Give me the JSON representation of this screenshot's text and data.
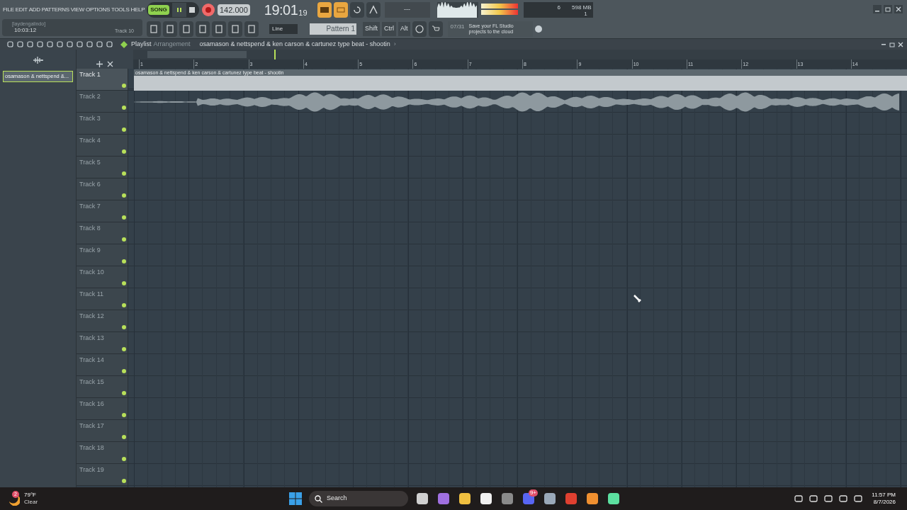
{
  "menu": [
    "FILE",
    "EDIT",
    "ADD",
    "PATTERNS",
    "VIEW",
    "OPTIONS",
    "TOOLS",
    "HELP"
  ],
  "transport": {
    "mode_label": "SONG",
    "song_mode": true,
    "playing": true,
    "tempo": "142.000",
    "time": "19:01",
    "time_seconds": "19",
    "monitor": "---"
  },
  "info": {
    "user": "[laydengalindo]",
    "time": "10:03:12",
    "track": "Track 10"
  },
  "resources": {
    "cpu": "6",
    "memory": "598 MB",
    "polyphony": "1"
  },
  "snap": "Line",
  "pattern": "Pattern 1",
  "mod_keys": [
    "Shift",
    "Ctrl",
    "Alt"
  ],
  "hint": {
    "date": "07/31",
    "text": "Save your FL Studio projects to the cloud"
  },
  "playlist": {
    "title": "Playlist",
    "subtitle": "Arrangement",
    "project": "osamason & nettspend & ken carson & cartunez type beat - shootin",
    "chevron": "›"
  },
  "picker_clip": "osamason & nettspend &...",
  "ruler": [
    "1",
    "2",
    "3",
    "4",
    "5",
    "6",
    "7",
    "8",
    "9",
    "10",
    "11",
    "12",
    "13",
    "14"
  ],
  "tracks": [
    {
      "name": "Track 1",
      "selected": true
    },
    {
      "name": "Track 2",
      "selected": false
    },
    {
      "name": "Track 3",
      "selected": false
    },
    {
      "name": "Track 4",
      "selected": false
    },
    {
      "name": "Track 5",
      "selected": false
    },
    {
      "name": "Track 6",
      "selected": false
    },
    {
      "name": "Track 7",
      "selected": false
    },
    {
      "name": "Track 8",
      "selected": false
    },
    {
      "name": "Track 9",
      "selected": false
    },
    {
      "name": "Track 10",
      "selected": false
    },
    {
      "name": "Track 11",
      "selected": false
    },
    {
      "name": "Track 12",
      "selected": false
    },
    {
      "name": "Track 13",
      "selected": false
    },
    {
      "name": "Track 14",
      "selected": false
    },
    {
      "name": "Track 15",
      "selected": false
    },
    {
      "name": "Track 16",
      "selected": false
    },
    {
      "name": "Track 17",
      "selected": false
    },
    {
      "name": "Track 18",
      "selected": false
    },
    {
      "name": "Track 19",
      "selected": false
    }
  ],
  "clip_title": "osamason & nettspend & ken carson & cartunez type beat - shootin",
  "taskbar": {
    "weather_badge": "2",
    "temperature": "79°F",
    "condition": "Clear",
    "search": "Search",
    "discord_badge": "9+",
    "clock": "11:57 PM",
    "date": "8/7/2026"
  }
}
